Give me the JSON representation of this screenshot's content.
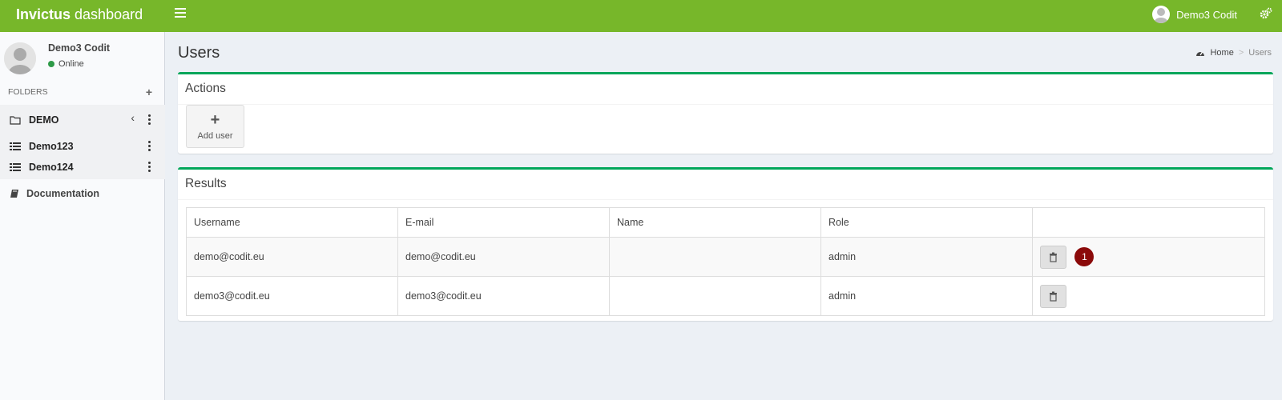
{
  "app": {
    "brand_bold": "Invictus",
    "brand_rest": " dashboard"
  },
  "topbar": {
    "user_name": "Demo3 Codit"
  },
  "sidebar": {
    "user_name": "Demo3 Codit",
    "status": "Online",
    "folders_heading": "FOLDERS",
    "folder": {
      "label": "DEMO"
    },
    "items": [
      {
        "label": "Demo123"
      },
      {
        "label": "Demo124"
      }
    ],
    "documentation": "Documentation"
  },
  "page": {
    "title": "Users"
  },
  "breadcrumb": {
    "home": "Home",
    "sep": ">",
    "current": "Users"
  },
  "actions": {
    "title": "Actions",
    "add_user_label": "Add user"
  },
  "results": {
    "title": "Results",
    "columns": [
      "Username",
      "E-mail",
      "Name",
      "Role",
      ""
    ],
    "rows": [
      {
        "username": "demo@codit.eu",
        "email": "demo@codit.eu",
        "name": "",
        "role": "admin",
        "badge": "1"
      },
      {
        "username": "demo3@codit.eu",
        "email": "demo3@codit.eu",
        "name": "",
        "role": "admin"
      }
    ]
  },
  "colors": {
    "topbar": "#77b72a",
    "box_border": "#00a65a",
    "badge": "#8b0a0a",
    "status_online": "#2e9a48"
  },
  "icons": [
    "hamburger-icon",
    "gear-icon",
    "folder-icon",
    "list-icon",
    "book-icon",
    "dashboard-icon",
    "trash-icon",
    "plus-icon",
    "chevron-left-icon",
    "more-vertical-icon"
  ]
}
